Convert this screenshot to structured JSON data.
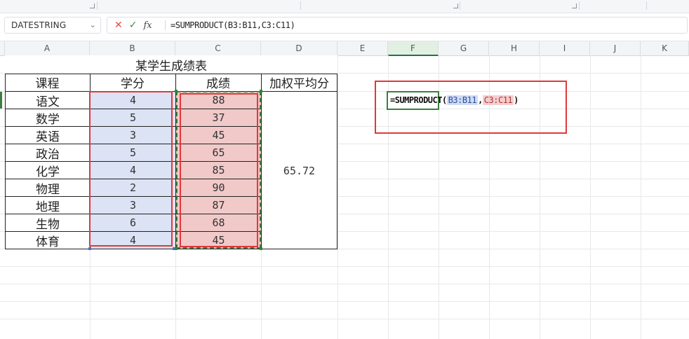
{
  "formula_bar": {
    "name_box": "DATESTRING",
    "cancel_glyph": "✕",
    "confirm_glyph": "✓",
    "fx_label": "fx",
    "formula": "=SUMPRODUCT(B3:B11,C3:C11)"
  },
  "columns": [
    "A",
    "B",
    "C",
    "D",
    "E",
    "F",
    "G",
    "H",
    "I",
    "J",
    "K"
  ],
  "selected_column": "F",
  "table": {
    "title": "某学生成绩表",
    "headers": [
      "课程",
      "学分",
      "成绩",
      "加权平均分"
    ],
    "rows": [
      {
        "course": "语文",
        "credit": "4",
        "score": "88"
      },
      {
        "course": "数学",
        "credit": "5",
        "score": "37"
      },
      {
        "course": "英语",
        "credit": "3",
        "score": "45"
      },
      {
        "course": "政治",
        "credit": "5",
        "score": "65"
      },
      {
        "course": "化学",
        "credit": "4",
        "score": "85"
      },
      {
        "course": "物理",
        "credit": "2",
        "score": "90"
      },
      {
        "course": "地理",
        "credit": "3",
        "score": "87"
      },
      {
        "course": "生物",
        "credit": "6",
        "score": "68"
      },
      {
        "course": "体育",
        "credit": "4",
        "score": "45"
      }
    ],
    "weighted_average": "65.72"
  },
  "cell_edit": {
    "prefix": "=SUMPRODUCT(",
    "ref1": "B3:B11",
    "separator": ",",
    "ref2": "C3:C11",
    "suffix": ")"
  },
  "colors": {
    "credit_highlight": "#dce3f4",
    "score_highlight": "#f1c9c9",
    "annotation_red": "#e0393a",
    "selection_green": "#3a7f3d"
  }
}
